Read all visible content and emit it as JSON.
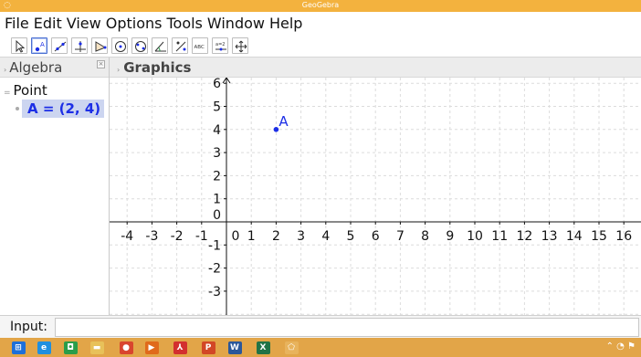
{
  "window": {
    "title": "GeoGebra",
    "app_icon": "geogebra-icon"
  },
  "menu": [
    "File",
    "Edit",
    "View",
    "Options",
    "Tools",
    "Window",
    "Help"
  ],
  "toolbar": {
    "tools": [
      {
        "name": "move-tool-icon"
      },
      {
        "name": "point-tool-icon",
        "selected": true
      },
      {
        "name": "line-tool-icon"
      },
      {
        "name": "perpendicular-tool-icon"
      },
      {
        "name": "polygon-tool-icon"
      },
      {
        "name": "circle-tool-icon"
      },
      {
        "name": "ellipse-tool-icon"
      },
      {
        "name": "angle-tool-icon"
      },
      {
        "name": "reflect-tool-icon"
      },
      {
        "name": "text-tool-icon",
        "text": "ABC"
      },
      {
        "name": "slider-tool-icon",
        "text": "a=2"
      },
      {
        "name": "move-view-tool-icon"
      }
    ]
  },
  "algebra": {
    "header": "Algebra",
    "close_glyph": "×",
    "category": "Point",
    "items": [
      {
        "label": "A = (2, 4)"
      }
    ]
  },
  "graphics": {
    "header": "Graphics",
    "x_ticks": [
      "-4",
      "-3",
      "-2",
      "-1",
      "0",
      "1",
      "2",
      "3",
      "4",
      "5",
      "6",
      "7",
      "8",
      "9",
      "10",
      "11",
      "12",
      "13",
      "14",
      "15",
      "16"
    ],
    "y_ticks": [
      "6",
      "5",
      "4",
      "3",
      "2",
      "1",
      "0",
      "-1",
      "-2",
      "-3"
    ],
    "points": [
      {
        "label": "A",
        "x": 2,
        "y": 4,
        "color": "#1c2ee6"
      }
    ],
    "axis_color": "#111111",
    "grid_color": "#dcdcdc"
  },
  "input": {
    "label": "Input:",
    "value": ""
  },
  "taskbar": {
    "items": [
      {
        "name": "windows-start-icon",
        "color": "#1e6fd9",
        "glyph": "⊞"
      },
      {
        "name": "internet-explorer-icon",
        "color": "#1f8fe0",
        "glyph": "e"
      },
      {
        "name": "store-icon",
        "color": "#2a9d4a",
        "glyph": "◘"
      },
      {
        "name": "file-explorer-icon",
        "color": "#e8c15a",
        "glyph": "▬"
      },
      {
        "name": "chrome-icon",
        "color": "#d9442e",
        "glyph": "●"
      },
      {
        "name": "media-player-icon",
        "color": "#e06a1b",
        "glyph": "▶"
      },
      {
        "name": "acrobat-icon",
        "color": "#d32f2f",
        "glyph": "⅄"
      },
      {
        "name": "powerpoint-icon",
        "color": "#d24726",
        "glyph": "P"
      },
      {
        "name": "word-icon",
        "color": "#2b579a",
        "glyph": "W"
      },
      {
        "name": "excel-icon",
        "color": "#217346",
        "glyph": "X"
      },
      {
        "name": "geogebra-taskbar-icon",
        "color": "#e8b35c",
        "glyph": "⬠"
      }
    ],
    "tray": "⌃ ◔ ⚑"
  }
}
